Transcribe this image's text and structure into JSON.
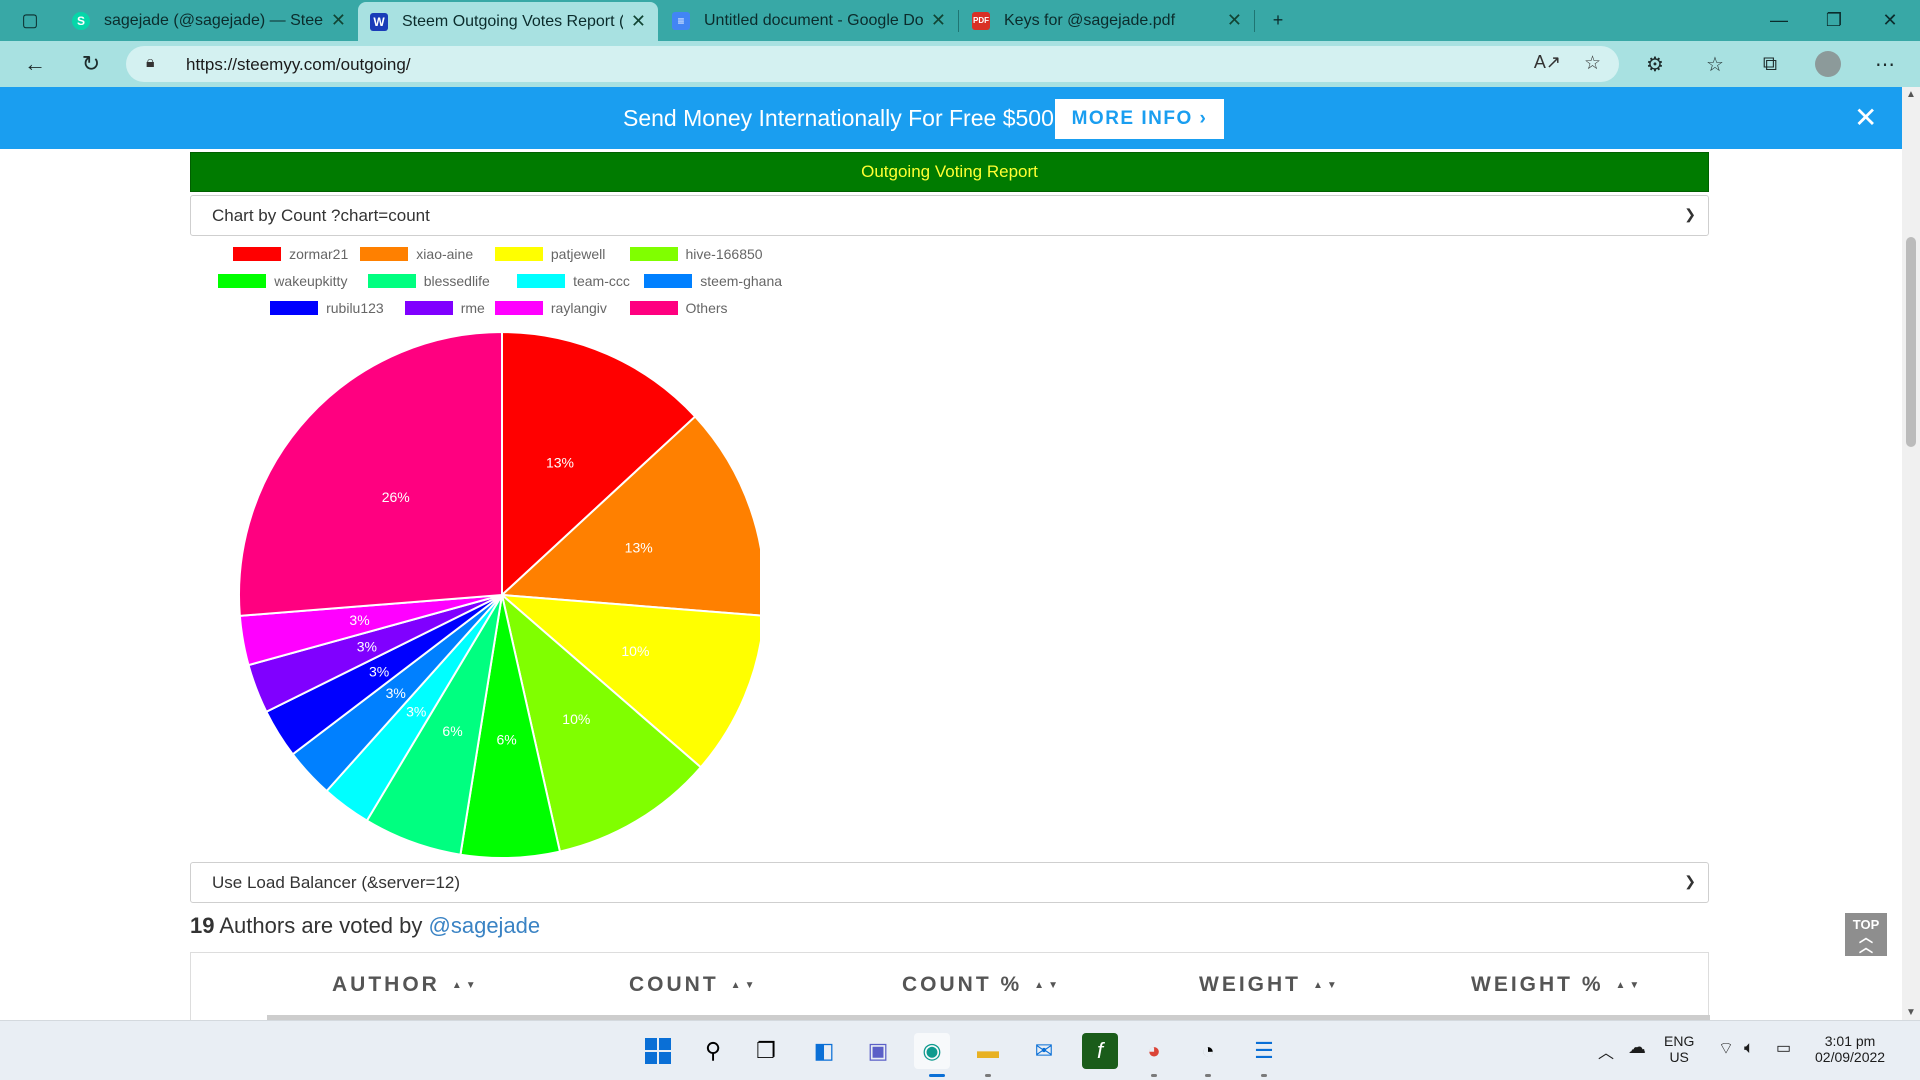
{
  "browser": {
    "tabs": [
      {
        "title": "sagejade (@sagejade) — Steemit",
        "icon": "steemit-icon"
      },
      {
        "title": "Steem Outgoing Votes Report (S",
        "icon": "steemyy-icon"
      },
      {
        "title": "Untitled document - Google Doc",
        "icon": "google-docs-icon"
      },
      {
        "title": "Keys for @sagejade.pdf",
        "icon": "pdf-icon"
      }
    ],
    "active_tab": 1,
    "url": "https://steemyy.com/outgoing/"
  },
  "banner": {
    "text": "Send Money Internationally For Free $500",
    "button_label": "MORE INFO ›",
    "close_label": "✕"
  },
  "report": {
    "title": "Outgoing Voting Report",
    "chart_select_value": "Chart by Count ?chart=count",
    "server_select_value": "Use Load Balancer (&server=12)",
    "author_count": "19",
    "summary_text": " Authors are voted by ",
    "user": "@sagejade",
    "table_headers": [
      "AUTHOR",
      "COUNT",
      "COUNT %",
      "WEIGHT",
      "WEIGHT %"
    ],
    "top_button": "TOP"
  },
  "chart_data": {
    "type": "pie",
    "title": "",
    "legend_position": "top",
    "slices": [
      {
        "label": "zormar21",
        "value": 13,
        "display": "13%",
        "color": "#ff0000"
      },
      {
        "label": "xiao-aine",
        "value": 13,
        "display": "13%",
        "color": "#ff8000"
      },
      {
        "label": "patjewell",
        "value": 10,
        "display": "10%",
        "color": "#ffff00"
      },
      {
        "label": "hive-166850",
        "value": 10,
        "display": "10%",
        "color": "#80ff00"
      },
      {
        "label": "wakeupkitty",
        "value": 6,
        "display": "6%",
        "color": "#00ff00"
      },
      {
        "label": "blessedlife",
        "value": 6,
        "display": "6%",
        "color": "#00ff80"
      },
      {
        "label": "team-ccc",
        "value": 3,
        "display": "3%",
        "color": "#00ffff"
      },
      {
        "label": "steem-ghana",
        "value": 3,
        "display": "3%",
        "color": "#0080ff"
      },
      {
        "label": "rubilu123",
        "value": 3,
        "display": "3%",
        "color": "#0000ff"
      },
      {
        "label": "rme",
        "value": 3,
        "display": "3%",
        "color": "#8000ff"
      },
      {
        "label": "raylangiv",
        "value": 3,
        "display": "3%",
        "color": "#ff00ff"
      },
      {
        "label": "Others",
        "value": 26,
        "display": "26%",
        "color": "#ff0080"
      }
    ]
  },
  "taskbar": {
    "lang_primary": "ENG",
    "lang_secondary": "US",
    "time": "3:01 pm",
    "date": "02/09/2022"
  }
}
